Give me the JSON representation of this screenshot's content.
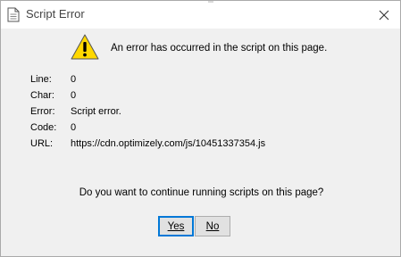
{
  "window": {
    "title": "Script Error"
  },
  "icons": {
    "title": "document-icon",
    "close": "close-icon",
    "warning": "warning-icon"
  },
  "message": "An error has occurred in the script on this page.",
  "details": [
    {
      "label": "Line:",
      "value": "0"
    },
    {
      "label": "Char:",
      "value": "0"
    },
    {
      "label": "Error:",
      "value": "Script error."
    },
    {
      "label": "Code:",
      "value": "0"
    },
    {
      "label": "URL:",
      "value": "https://cdn.optimizely.com/js/10451337354.js"
    }
  ],
  "question": "Do you want to continue running scripts on this page?",
  "buttons": {
    "yes": "Yes",
    "no": "No"
  },
  "colors": {
    "warning_fill": "#ffd800",
    "focus_border": "#0078d7",
    "button_bg": "#e1e1e1"
  }
}
